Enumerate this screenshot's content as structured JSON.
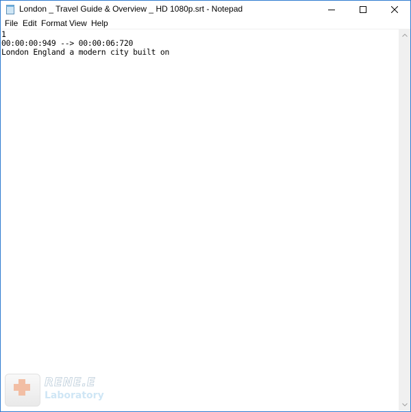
{
  "window": {
    "title": "London _ Travel Guide & Overview _ HD 1080p.srt - Notepad",
    "accent_color": "#2b79d0",
    "controls": [
      "minimize-icon",
      "maximize-icon",
      "close-icon"
    ]
  },
  "menu": {
    "items": [
      "File",
      "Edit",
      "Format",
      "View",
      "Help"
    ]
  },
  "editor": {
    "lines": [
      "1",
      "00:00:00:949 --> 00:00:06:720",
      "London England a modern city built on"
    ]
  },
  "watermark": {
    "brand": "RENE.E",
    "sub": "Laboratory"
  }
}
